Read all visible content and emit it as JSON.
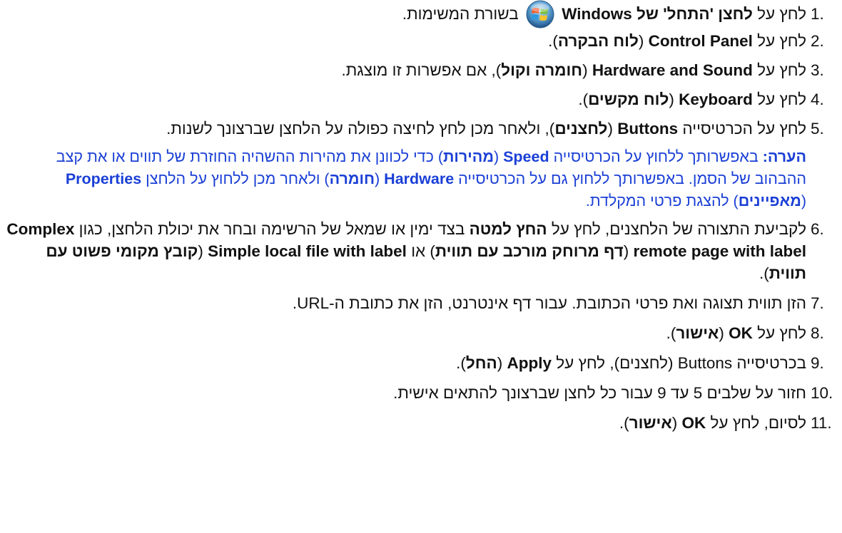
{
  "steps": [
    {
      "num": "1.",
      "a": "לחץ על ",
      "b1": "לחצן 'התחל' של Windows",
      "c": " בשורת המשימות."
    },
    {
      "num": "2.",
      "a": "לחץ על ",
      "b1": "Control Panel",
      "c": " (",
      "b2": "לוח הבקרה",
      "d": ")."
    },
    {
      "num": "3.",
      "a": "לחץ על ",
      "b1": "Hardware and Sound",
      "c": " (",
      "b2": "חומרה וקול",
      "d": "), אם אפשרות זו מוצגת."
    },
    {
      "num": "4.",
      "a": "לחץ על ",
      "b1": "Keyboard",
      "c": " (",
      "b2": "לוח מקשים",
      "d": ")."
    },
    {
      "num": "5.",
      "a": "לחץ על הכרטיסייה ",
      "b1": "Buttons",
      "c": " (",
      "b2": "לחצנים",
      "d": "), ולאחר מכן לחץ לחיצה כפולה על הלחצן שברצונך לשנות."
    },
    {
      "num": "6.",
      "a": "לקביעת התצורה של הלחצנים, לחץ על ",
      "b1": "החץ למטה",
      "c": " בצד ימין או שמאל של הרשימה ובחר את יכולת הלחצן, כגון ",
      "b2": "Complex remote page with label",
      "d": " (",
      "b3": "דף מרוחק מורכב עם תווית",
      "e": ") או ",
      "b4": "Simple local file with label",
      "f": " (",
      "b5": "קובץ מקומי פשוט עם תווית",
      "g": ")."
    },
    {
      "num": "7.",
      "a": "הזן תווית תצוגה ואת פרטי הכתובת. עבור דף אינטרנט, הזן את כתובת ה-URL."
    },
    {
      "num": "8.",
      "a": "לחץ על ",
      "b1": "OK",
      "c": " (",
      "b2": "אישור",
      "d": ")."
    },
    {
      "num": "9.",
      "a": "בכרטיסייה Buttons (לחצנים), לחץ על ",
      "b1": "Apply",
      "c": " (",
      "b2": "החל",
      "d": ")."
    },
    {
      "num": "10.",
      "a": "חזור על שלבים 5 עד 9 עבור כל לחצן שברצונך להתאים אישית."
    },
    {
      "num": "11.",
      "a": "לסיום, לחץ על ",
      "b1": "OK",
      "c": " (",
      "b2": "אישור",
      "d": ")."
    }
  ],
  "note": {
    "label": "הערה:",
    "t1": " באפשרותך ללחוץ על הכרטיסייה ",
    "b1": "Speed",
    "t2": " (",
    "b2": "מהירות",
    "t3": ") כדי לכוונן את מהירות ההשהיה החוזרת של תווים או את קצב ההבהוב של הסמן. באפשרותך ללחוץ גם על הכרטיסייה ",
    "b3": "Hardware",
    "t4": " (",
    "b4": "חומרה",
    "t5": ") ולאחר מכן ללחוץ על הלחצן ",
    "b5": "Properties",
    "t6": " (",
    "b6": "מאפיינים",
    "t7": ") להצגת פרטי המקלדת."
  },
  "icons": {
    "start_button": "windows-start-orb-icon"
  },
  "colors": {
    "note_text": "#1a3fd6",
    "body_text": "#111111"
  }
}
